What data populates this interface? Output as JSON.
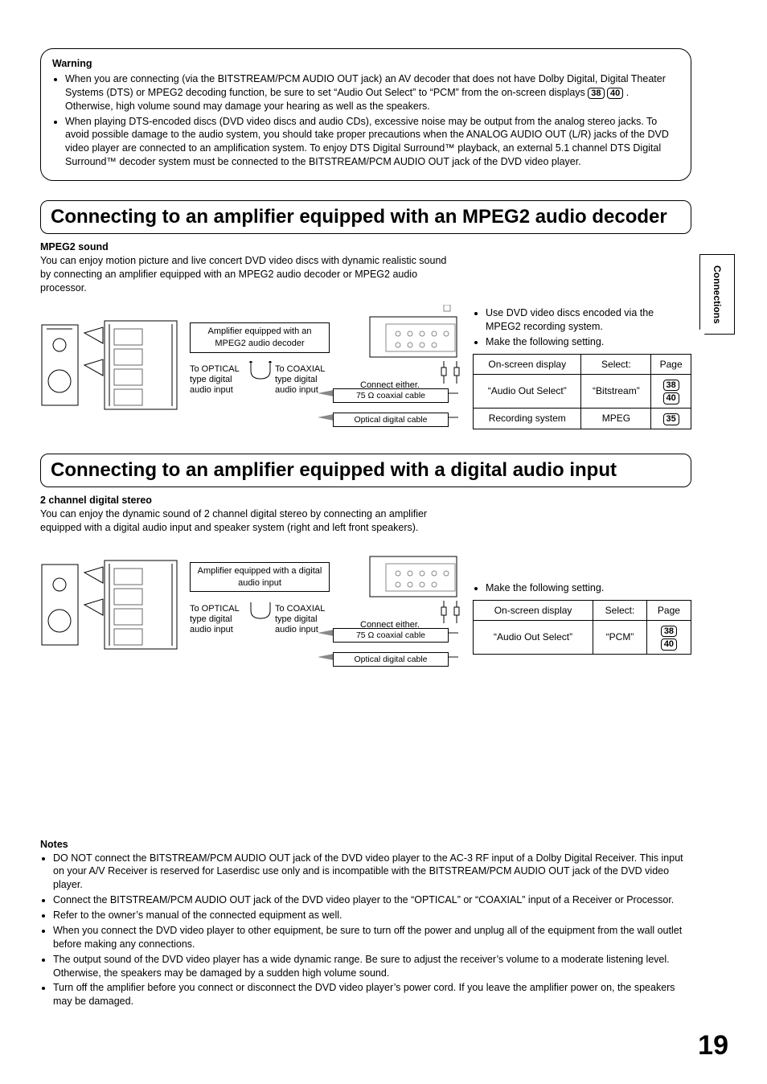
{
  "sideTab": "Connections",
  "warning": {
    "title": "Warning",
    "items": [
      "When you are connecting (via the BITSTREAM/PCM AUDIO OUT jack) an AV decoder that does not have Dolby Digital, Digital Theater Systems (DTS) or MPEG2 decoding function, be sure to set “Audio Out Select” to “PCM” from the on-screen displays ",
      " . Otherwise, high volume sound may damage your hearing as well as the speakers.",
      "When playing DTS-encoded discs (DVD video discs and audio CDs), excessive noise may be output from the analog stereo jacks.  To avoid possible damage to the audio system, you should take proper precautions when the ANALOG AUDIO OUT (L/R) jacks of the DVD video player are connected to an amplification system.  To enjoy DTS Digital Surround™ playback, an external 5.1 channel DTS Digital Surround™ decoder system must be connected to the BITSTREAM/PCM AUDIO OUT jack of the DVD video player."
    ],
    "pgref1": "38",
    "pgref2": "40"
  },
  "section1": {
    "heading": "Connecting to an amplifier equipped with an MPEG2 audio decoder",
    "subhead": "MPEG2 sound",
    "intro": "You can enjoy motion picture and live concert DVD video discs with dynamic realistic sound by connecting an amplifier equipped with an MPEG2 audio decoder or MPEG2 audio processor.",
    "ampLabel": "Amplifier equipped with an MPEG2 audio decoder",
    "optLabel": "To OPTICAL type digital audio input",
    "coaxLabel": "To COAXIAL type digital audio input",
    "connectEither": "Connect either.",
    "coaxCable": "75 Ω coaxial cable",
    "optCable": "Optical digital cable",
    "rightBullets": [
      "Use DVD video discs encoded via the MPEG2 recording system.",
      "Make the following setting."
    ],
    "table": {
      "h1": "On-screen display",
      "h2": "Select:",
      "h3": "Page",
      "r1c1": "“Audio Out Select”",
      "r1c2": "“Bitstream”",
      "r1p1": "38",
      "r1p2": "40",
      "r2c1": "Recording system",
      "r2c2": "MPEG",
      "r2p1": "35"
    }
  },
  "section2": {
    "heading": "Connecting to an amplifier equipped with a digital audio input",
    "subhead": "2 channel digital stereo",
    "intro": "You can enjoy the dynamic sound of 2 channel digital stereo by connecting an amplifier equipped with a digital audio input and speaker system (right and left front speakers).",
    "ampLabel": "Amplifier equipped with a digital audio input",
    "optLabel": "To OPTICAL type digital audio input",
    "coaxLabel": "To COAXIAL type digital audio input",
    "connectEither": "Connect either.",
    "coaxCable": "75 Ω coaxial cable",
    "optCable": "Optical digital cable",
    "rightBullets": [
      "Make the following setting."
    ],
    "table": {
      "h1": "On-screen display",
      "h2": "Select:",
      "h3": "Page",
      "r1c1": "“Audio Out Select”",
      "r1c2": "“PCM”",
      "r1p1": "38",
      "r1p2": "40"
    }
  },
  "notes": {
    "title": "Notes",
    "items": [
      "DO NOT connect the BITSTREAM/PCM AUDIO OUT jack of the DVD video player to the AC-3 RF input of a Dolby Digital Receiver.  This input on your A/V Receiver is reserved for Laserdisc use only and is incompatible with the BITSTREAM/PCM AUDIO OUT jack of the DVD video player.",
      "Connect the BITSTREAM/PCM AUDIO OUT jack of the DVD video player to the “OPTICAL” or “COAXIAL” input of a Receiver or Processor.",
      "Refer to the owner’s manual of the connected equipment as well.",
      "When you connect the DVD video player to other equipment, be sure to turn off the power and unplug all of the equipment from the wall outlet before making any connections.",
      "The output sound of the DVD video player has a wide dynamic range. Be sure to adjust the receiver’s volume to a moderate listening level. Otherwise, the speakers may be damaged by a sudden high volume sound.",
      "Turn off the amplifier before you connect or disconnect the DVD video player’s power cord. If you leave the amplifier power on, the speakers may be damaged."
    ]
  },
  "pageNumber": "19"
}
